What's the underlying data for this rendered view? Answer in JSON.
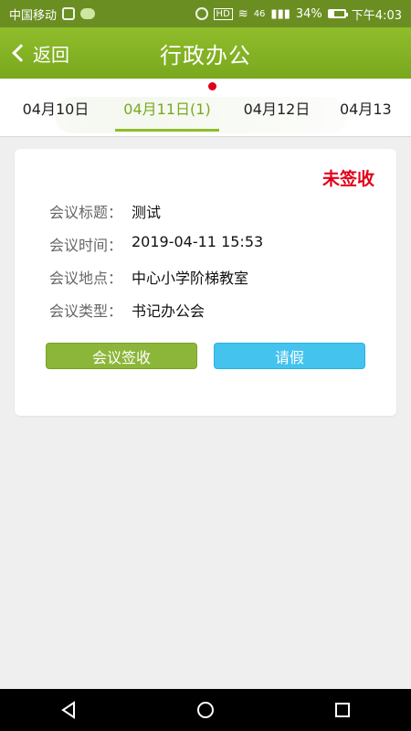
{
  "status_bar": {
    "carrier": "中国移动",
    "right_text": "46",
    "battery_percent": "34%",
    "battery_level": 0.34,
    "time": "下午4:03"
  },
  "header": {
    "back_label": "返回",
    "title": "行政办公"
  },
  "date_tabs": [
    {
      "label": "04月10日"
    },
    {
      "label": "04月11日(1)"
    },
    {
      "label": "04月12日"
    },
    {
      "label": "04月13"
    }
  ],
  "card": {
    "status": "未签收",
    "rows": [
      {
        "label": "会议标题：",
        "value": "测试"
      },
      {
        "label": "会议时间：",
        "value": "2019-04-11 15:53"
      },
      {
        "label": "会议地点：",
        "value": "中心小学阶梯教室"
      },
      {
        "label": "会议类型：",
        "value": "书记办公会"
      }
    ],
    "buttons": {
      "sign": "会议签收",
      "leave": "请假"
    }
  },
  "colors": {
    "header_green": "#8fbd2b",
    "active_tab": "#79a81e",
    "status_red": "#e0001a",
    "sign_button": "#8cb63a",
    "leave_button": "#44c3ee"
  }
}
